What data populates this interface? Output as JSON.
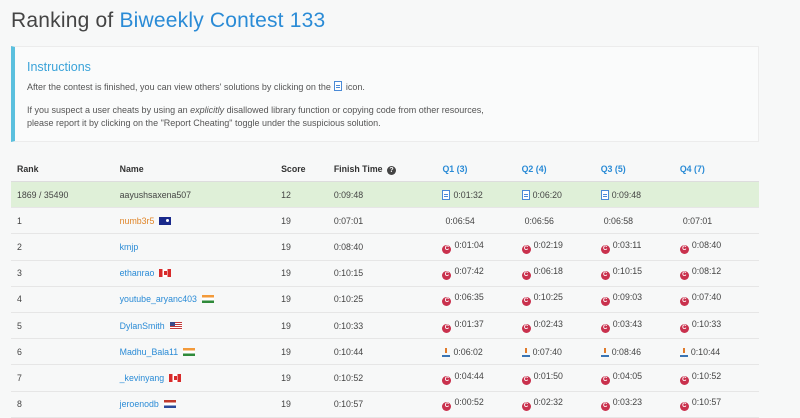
{
  "title": {
    "prefix": "Ranking of ",
    "contest": "Biweekly Contest 133"
  },
  "instructions": {
    "title": "Instructions",
    "line1_before": "After the contest is finished, you can view others' solutions by clicking on the",
    "line1_after": "icon.",
    "line2a_before": "If you suspect a user cheats by using an",
    "line2a_em": "explicitly",
    "line2a_after": "disallowed library function or copying code from other resources,",
    "line2b": "please report it by clicking on the \"Report Cheating\" toggle under the suspicious solution."
  },
  "table": {
    "headers": {
      "rank": "Rank",
      "name": "Name",
      "score": "Score",
      "finish_time": "Finish Time",
      "q1": "Q1 (3)",
      "q2": "Q2 (4)",
      "q3": "Q3 (5)",
      "q4": "Q4 (7)"
    },
    "rows": [
      {
        "rank": "1869 / 35490",
        "name": "aayushsaxena507",
        "flag": "",
        "score": "12",
        "finish": "0:09:48",
        "q1": "0:01:32",
        "q2": "0:06:20",
        "q3": "0:09:48",
        "q4": "",
        "lang": "doc",
        "highlight": true
      },
      {
        "rank": "1",
        "name": "numb3r5",
        "flag": "au",
        "name_color": "orange",
        "score": "19",
        "finish": "0:07:01",
        "q1": "0:06:54",
        "q2": "0:06:56",
        "q3": "0:06:58",
        "q4": "0:07:01",
        "lang": "python"
      },
      {
        "rank": "2",
        "name": "kmjp",
        "flag": "",
        "score": "19",
        "finish": "0:08:40",
        "q1": "0:01:04",
        "q2": "0:02:19",
        "q3": "0:03:11",
        "q4": "0:08:40",
        "lang": "cpp"
      },
      {
        "rank": "3",
        "name": "ethanrao",
        "flag": "ca",
        "score": "19",
        "finish": "0:10:15",
        "q1": "0:07:42",
        "q2": "0:06:18",
        "q3": "0:10:15",
        "q4": "0:08:12",
        "lang": "cpp"
      },
      {
        "rank": "4",
        "name": "youtube_aryanc403",
        "flag": "in",
        "score": "19",
        "finish": "0:10:25",
        "q1": "0:06:35",
        "q2": "0:10:25",
        "q3": "0:09:03",
        "q4": "0:07:40",
        "lang": "cpp"
      },
      {
        "rank": "5",
        "name": "DylanSmith",
        "flag": "us",
        "score": "19",
        "finish": "0:10:33",
        "q1": "0:01:37",
        "q2": "0:02:43",
        "q3": "0:03:43",
        "q4": "0:10:33",
        "lang": "cpp"
      },
      {
        "rank": "6",
        "name": "Madhu_Bala11",
        "flag": "in",
        "score": "19",
        "finish": "0:10:44",
        "q1": "0:06:02",
        "q2": "0:07:40",
        "q3": "0:08:46",
        "q4": "0:10:44",
        "lang": "java"
      },
      {
        "rank": "7",
        "name": "_kevinyang",
        "flag": "ca",
        "score": "19",
        "finish": "0:10:52",
        "q1": "0:04:44",
        "q2": "0:01:50",
        "q3": "0:04:05",
        "q4": "0:10:52",
        "lang": "cpp"
      },
      {
        "rank": "8",
        "name": "jeroenodb",
        "flag": "nl",
        "score": "19",
        "finish": "0:10:57",
        "q1": "0:00:52",
        "q2": "0:02:32",
        "q3": "0:03:23",
        "q4": "0:10:57",
        "lang": "cpp"
      }
    ]
  }
}
